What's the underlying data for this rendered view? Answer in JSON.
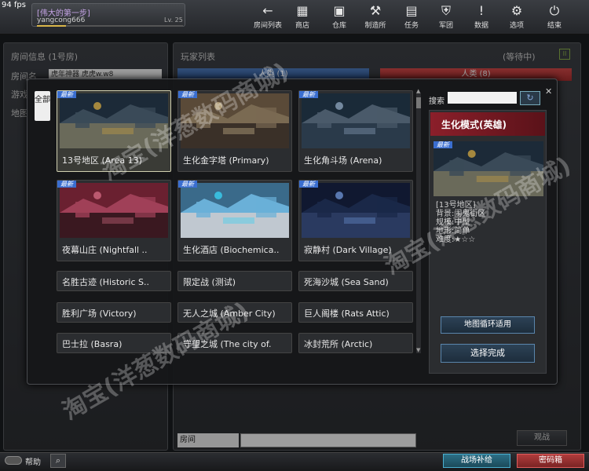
{
  "fps": "94 fps",
  "player": {
    "title": "[伟大的第一步]",
    "name": "yangcong666",
    "level": "Lv. 25",
    "exp_fraction": 0.2
  },
  "nav": [
    {
      "id": "back",
      "icon": "arrow-left-icon",
      "glyph": "←",
      "label": "房间列表"
    },
    {
      "id": "shop",
      "icon": "shop-icon",
      "glyph": "▦",
      "label": "商店"
    },
    {
      "id": "warehouse",
      "icon": "warehouse-icon",
      "glyph": "▣",
      "label": "仓库"
    },
    {
      "id": "workshop",
      "icon": "wrench-icon",
      "glyph": "⚒",
      "label": "制造所"
    },
    {
      "id": "mission",
      "icon": "ticket-icon",
      "glyph": "▤",
      "label": "任务"
    },
    {
      "id": "clan",
      "icon": "shield-icon",
      "glyph": "⛨",
      "label": "军团"
    },
    {
      "id": "data",
      "icon": "info-icon",
      "glyph": "!",
      "label": "数据"
    },
    {
      "id": "options",
      "icon": "gear-icon",
      "glyph": "⚙",
      "label": "选项"
    },
    {
      "id": "quit",
      "icon": "power-icon",
      "glyph": "⏻",
      "label": "结束"
    }
  ],
  "room_info": {
    "title": "房间信息 (1号房)",
    "name_label": "房间名",
    "name_value": "虎年神器 虎虎w.w8",
    "label2": "游戏",
    "label3": "地图"
  },
  "player_list": {
    "title": "玩家列表",
    "status": "(等待中)",
    "team_human": "人类 (1)",
    "team_zombie": "人类 (8)"
  },
  "modal": {
    "tab_all": "全部",
    "new_badge": "最新",
    "maps_featured": [
      {
        "name": "13号地区 (Area 13)",
        "new": true,
        "selected": true,
        "theme": "night"
      },
      {
        "name": "生化金字塔 (Primary)",
        "new": true,
        "selected": false,
        "theme": "desert"
      },
      {
        "name": "生化角斗场 (Arena)",
        "new": true,
        "selected": false,
        "theme": "arena"
      },
      {
        "name": "夜幕山庄 (Nightfall ..",
        "new": true,
        "selected": false,
        "theme": "red"
      },
      {
        "name": "生化酒店 (Biochemica..",
        "new": true,
        "selected": false,
        "theme": "pool"
      },
      {
        "name": "寂静村 (Dark Village)",
        "new": true,
        "selected": false,
        "theme": "village"
      }
    ],
    "maps_list": [
      "名胜古迹 (Historic S..",
      "限定战 (测试)",
      "死海沙城 (Sea Sand)",
      "胜利广场 (Victory)",
      "无人之城 (Amber City)",
      "巨人阁楼 (Rats Attic)",
      "巴士拉 (Basra)",
      "守望之城 (The city of.",
      "冰封荒所 (Arctic)"
    ],
    "search_label": "搜索",
    "detail": {
      "mode_title": "生化模式(英雄)",
      "info_lines": [
        "[13号地区]",
        "背景:闹鬼街区",
        "规模:中型",
        "地形:简单",
        "难度:★☆☆"
      ],
      "loop_button": "地图循环适用",
      "done_button": "选择完成"
    }
  },
  "bottom": {
    "help": "帮助",
    "supply": "战场补给",
    "safebox": "密码箱",
    "spectate": "观战",
    "chat_channel": "房间"
  },
  "watermark": "淘宝(洋葱数码商城)"
}
